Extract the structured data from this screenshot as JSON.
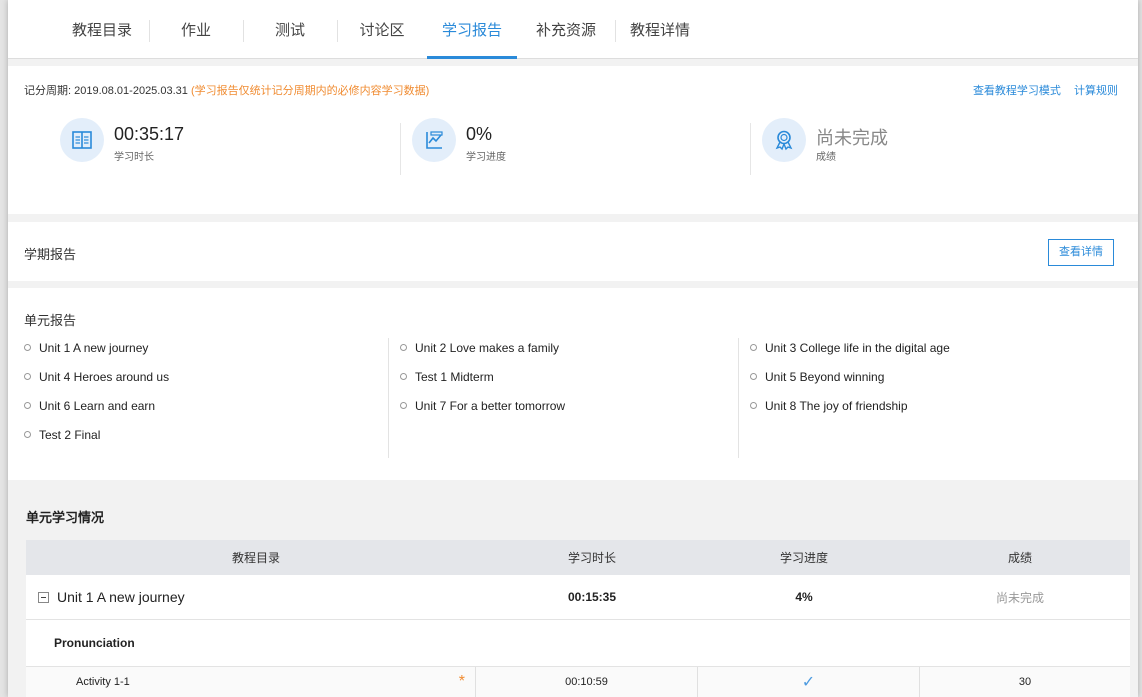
{
  "tabs": [
    {
      "label": "教程目录",
      "active": false
    },
    {
      "label": "作业",
      "active": false
    },
    {
      "label": "测试",
      "active": false
    },
    {
      "label": "讨论区",
      "active": false
    },
    {
      "label": "学习报告",
      "active": true
    },
    {
      "label": "补充资源",
      "active": false
    },
    {
      "label": "教程详情",
      "active": false
    }
  ],
  "summary": {
    "period_label": "记分周期: 2019.08.01-2025.03.31",
    "period_note": "(学习报告仅统计记分周期内的必修内容学习数据)",
    "links": [
      "查看教程学习模式",
      "计算规则"
    ],
    "stats": [
      {
        "icon": "book-icon",
        "value": "00:35:17",
        "label": "学习时长"
      },
      {
        "icon": "chart-icon",
        "value": "0%",
        "label": "学习进度"
      },
      {
        "icon": "award-icon",
        "value": "尚未完成",
        "label": "成绩"
      }
    ]
  },
  "term_report": {
    "title": "学期报告",
    "button": "查看详情"
  },
  "unit_report": {
    "title": "单元报告",
    "columns": [
      [
        "Unit 1 A new journey",
        "Unit 4 Heroes around us",
        "Unit 6 Learn and earn",
        "Test 2 Final"
      ],
      [
        "Unit 2 Love makes a family",
        "Test 1 Midterm",
        "Unit 7 For a better tomorrow"
      ],
      [
        "Unit 3 College life in the digital age",
        "Unit 5 Beyond winning",
        "Unit 8 The joy of friendship"
      ]
    ]
  },
  "unit_progress": {
    "title": "单元学习情况",
    "headers": [
      "教程目录",
      "学习时长",
      "学习进度",
      "成绩"
    ],
    "unit": {
      "name": "Unit 1 A new journey",
      "time": "00:15:35",
      "progress": "4%",
      "score": "尚未完成"
    },
    "subsection": "Pronunciation",
    "activity": {
      "name": "Activity 1-1",
      "mark": "*",
      "time": "00:10:59",
      "done": "✓",
      "score": "30"
    }
  },
  "colors": {
    "accent": "#2a8ad9",
    "note": "#f08c32"
  }
}
